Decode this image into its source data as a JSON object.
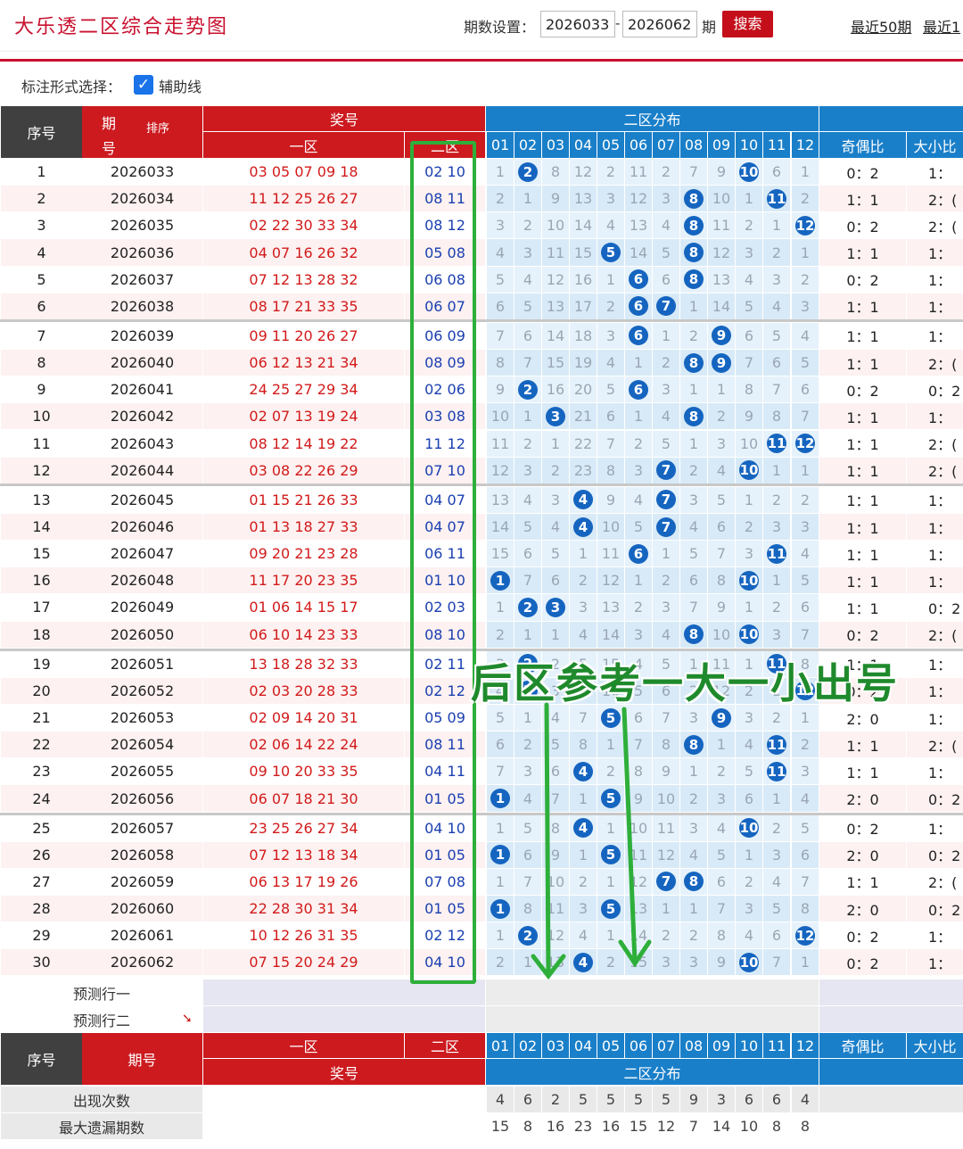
{
  "header": {
    "title": "大乐透二区综合走势图",
    "period_label": "期数设置：",
    "start_period": "2026033",
    "dash": "-",
    "end_period": "2026062",
    "period_suffix": "期",
    "search_label": "搜索",
    "links": [
      "最近50期",
      "最近1"
    ]
  },
  "options": {
    "label": "标注形式选择：",
    "checkbox_label": "辅助线",
    "checked": true
  },
  "table_header": {
    "seq": "序号",
    "period": "期",
    "period2": "号",
    "sort": "排序",
    "prize": "奖号",
    "zone1": "一区",
    "zone2": "二区",
    "dist": "二区分布",
    "columns": [
      "01",
      "02",
      "03",
      "04",
      "05",
      "06",
      "07",
      "08",
      "09",
      "10",
      "11",
      "12"
    ],
    "oe": "奇偶比",
    "bs": "大小比"
  },
  "rows": [
    {
      "n": "1",
      "p": "2026033",
      "a": "03 05 07 09 18",
      "b": "02 10",
      "m": [
        "1",
        "●2",
        "8",
        "12",
        "2",
        "11",
        "2",
        "7",
        "9",
        "●10",
        "6",
        "1"
      ],
      "oe": "0：2",
      "bs": "1："
    },
    {
      "n": "2",
      "p": "2026034",
      "a": "11 12 25 26 27",
      "b": "08 11",
      "m": [
        "2",
        "1",
        "9",
        "13",
        "3",
        "12",
        "3",
        "●8",
        "10",
        "1",
        "●11",
        "2"
      ],
      "oe": "1：1",
      "bs": "2：("
    },
    {
      "n": "3",
      "p": "2026035",
      "a": "02 22 30 33 34",
      "b": "08 12",
      "m": [
        "3",
        "2",
        "10",
        "14",
        "4",
        "13",
        "4",
        "●8",
        "11",
        "2",
        "1",
        "●12"
      ],
      "oe": "0：2",
      "bs": "2：("
    },
    {
      "n": "4",
      "p": "2026036",
      "a": "04 07 16 26 32",
      "b": "05 08",
      "m": [
        "4",
        "3",
        "11",
        "15",
        "●5",
        "14",
        "5",
        "●8",
        "12",
        "3",
        "2",
        "1"
      ],
      "oe": "1：1",
      "bs": "1："
    },
    {
      "n": "5",
      "p": "2026037",
      "a": "07 12 13 28 32",
      "b": "06 08",
      "m": [
        "5",
        "4",
        "12",
        "16",
        "1",
        "●6",
        "6",
        "●8",
        "13",
        "4",
        "3",
        "2"
      ],
      "oe": "0：2",
      "bs": "1："
    },
    {
      "n": "6",
      "p": "2026038",
      "a": "08 17 21 33 35",
      "b": "06 07",
      "m": [
        "6",
        "5",
        "13",
        "17",
        "2",
        "●6",
        "●7",
        "1",
        "14",
        "5",
        "4",
        "3"
      ],
      "oe": "1：1",
      "bs": "1："
    },
    {
      "n": "7",
      "p": "2026039",
      "a": "09 11 20 26 27",
      "b": "06 09",
      "m": [
        "7",
        "6",
        "14",
        "18",
        "3",
        "●6",
        "1",
        "2",
        "●9",
        "6",
        "5",
        "4"
      ],
      "oe": "1：1",
      "bs": "1："
    },
    {
      "n": "8",
      "p": "2026040",
      "a": "06 12 13 21 34",
      "b": "08 09",
      "m": [
        "8",
        "7",
        "15",
        "19",
        "4",
        "1",
        "2",
        "●8",
        "●9",
        "7",
        "6",
        "5"
      ],
      "oe": "1：1",
      "bs": "2：("
    },
    {
      "n": "9",
      "p": "2026041",
      "a": "24 25 27 29 34",
      "b": "02 06",
      "m": [
        "9",
        "●2",
        "16",
        "20",
        "5",
        "●6",
        "3",
        "1",
        "1",
        "8",
        "7",
        "6"
      ],
      "oe": "0：2",
      "bs": "0：2"
    },
    {
      "n": "10",
      "p": "2026042",
      "a": "02 07 13 19 24",
      "b": "03 08",
      "m": [
        "10",
        "1",
        "●3",
        "21",
        "6",
        "1",
        "4",
        "●8",
        "2",
        "9",
        "8",
        "7"
      ],
      "oe": "1：1",
      "bs": "1："
    },
    {
      "n": "11",
      "p": "2026043",
      "a": "08 12 14 19 22",
      "b": "11 12",
      "m": [
        "11",
        "2",
        "1",
        "22",
        "7",
        "2",
        "5",
        "1",
        "3",
        "10",
        "●11",
        "●12"
      ],
      "oe": "1：1",
      "bs": "2：("
    },
    {
      "n": "12",
      "p": "2026044",
      "a": "03 08 22 26 29",
      "b": "07 10",
      "m": [
        "12",
        "3",
        "2",
        "23",
        "8",
        "3",
        "●7",
        "2",
        "4",
        "●10",
        "1",
        "1"
      ],
      "oe": "1：1",
      "bs": "2：("
    },
    {
      "n": "13",
      "p": "2026045",
      "a": "01 15 21 26 33",
      "b": "04 07",
      "m": [
        "13",
        "4",
        "3",
        "●4",
        "9",
        "4",
        "●7",
        "3",
        "5",
        "1",
        "2",
        "2"
      ],
      "oe": "1：1",
      "bs": "1："
    },
    {
      "n": "14",
      "p": "2026046",
      "a": "01 13 18 27 33",
      "b": "04 07",
      "m": [
        "14",
        "5",
        "4",
        "●4",
        "10",
        "5",
        "●7",
        "4",
        "6",
        "2",
        "3",
        "3"
      ],
      "oe": "1：1",
      "bs": "1："
    },
    {
      "n": "15",
      "p": "2026047",
      "a": "09 20 21 23 28",
      "b": "06 11",
      "m": [
        "15",
        "6",
        "5",
        "1",
        "11",
        "●6",
        "1",
        "5",
        "7",
        "3",
        "●11",
        "4"
      ],
      "oe": "1：1",
      "bs": "1："
    },
    {
      "n": "16",
      "p": "2026048",
      "a": "11 17 20 23 35",
      "b": "01 10",
      "m": [
        "●1",
        "7",
        "6",
        "2",
        "12",
        "1",
        "2",
        "6",
        "8",
        "●10",
        "1",
        "5"
      ],
      "oe": "1：1",
      "bs": "1："
    },
    {
      "n": "17",
      "p": "2026049",
      "a": "01 06 14 15 17",
      "b": "02 03",
      "m": [
        "1",
        "●2",
        "●3",
        "3",
        "13",
        "2",
        "3",
        "7",
        "9",
        "1",
        "2",
        "6"
      ],
      "oe": "1：1",
      "bs": "0：2"
    },
    {
      "n": "18",
      "p": "2026050",
      "a": "06 10 14 23 33",
      "b": "08 10",
      "m": [
        "2",
        "1",
        "1",
        "4",
        "14",
        "3",
        "4",
        "●8",
        "10",
        "●10",
        "3",
        "7"
      ],
      "oe": "0：2",
      "bs": "2：("
    },
    {
      "n": "19",
      "p": "2026051",
      "a": "13 18 28 32 33",
      "b": "02 11",
      "m": [
        "3",
        "●2",
        "2",
        "5",
        "15",
        "4",
        "5",
        "1",
        "11",
        "1",
        "●11",
        "8"
      ],
      "oe": "1：1",
      "bs": "1："
    },
    {
      "n": "20",
      "p": "2026052",
      "a": "02 03 20 28 33",
      "b": "02 12",
      "m": [
        "4",
        "●2",
        "3",
        "6",
        "16",
        "5",
        "6",
        "2",
        "12",
        "2",
        "1",
        "●12"
      ],
      "oe": "0：2",
      "bs": "1："
    },
    {
      "n": "21",
      "p": "2026053",
      "a": "02 09 14 20 31",
      "b": "05 09",
      "m": [
        "5",
        "1",
        "4",
        "7",
        "●5",
        "6",
        "7",
        "3",
        "●9",
        "3",
        "2",
        "1"
      ],
      "oe": "2：0",
      "bs": "1："
    },
    {
      "n": "22",
      "p": "2026054",
      "a": "02 06 14 22 24",
      "b": "08 11",
      "m": [
        "6",
        "2",
        "5",
        "8",
        "1",
        "7",
        "8",
        "●8",
        "1",
        "4",
        "●11",
        "2"
      ],
      "oe": "1：1",
      "bs": "2：("
    },
    {
      "n": "23",
      "p": "2026055",
      "a": "09 10 20 33 35",
      "b": "04 11",
      "m": [
        "7",
        "3",
        "6",
        "●4",
        "2",
        "8",
        "9",
        "1",
        "2",
        "5",
        "●11",
        "3"
      ],
      "oe": "1：1",
      "bs": "1："
    },
    {
      "n": "24",
      "p": "2026056",
      "a": "06 07 18 21 30",
      "b": "01 05",
      "m": [
        "●1",
        "4",
        "7",
        "1",
        "●5",
        "9",
        "10",
        "2",
        "3",
        "6",
        "1",
        "4"
      ],
      "oe": "2：0",
      "bs": "0：2"
    },
    {
      "n": "25",
      "p": "2026057",
      "a": "23 25 26 27 34",
      "b": "04 10",
      "m": [
        "1",
        "5",
        "8",
        "●4",
        "1",
        "10",
        "11",
        "3",
        "4",
        "●10",
        "2",
        "5"
      ],
      "oe": "0：2",
      "bs": "1："
    },
    {
      "n": "26",
      "p": "2026058",
      "a": "07 12 13 18 34",
      "b": "01 05",
      "m": [
        "●1",
        "6",
        "9",
        "1",
        "●5",
        "11",
        "12",
        "4",
        "5",
        "1",
        "3",
        "6"
      ],
      "oe": "2：0",
      "bs": "0：2"
    },
    {
      "n": "27",
      "p": "2026059",
      "a": "06 13 17 19 26",
      "b": "07 08",
      "m": [
        "1",
        "7",
        "10",
        "2",
        "1",
        "12",
        "●7",
        "●8",
        "6",
        "2",
        "4",
        "7"
      ],
      "oe": "1：1",
      "bs": "2：("
    },
    {
      "n": "28",
      "p": "2026060",
      "a": "22 28 30 31 34",
      "b": "01 05",
      "m": [
        "●1",
        "8",
        "11",
        "3",
        "●5",
        "13",
        "1",
        "1",
        "7",
        "3",
        "5",
        "8"
      ],
      "oe": "2：0",
      "bs": "0：2"
    },
    {
      "n": "29",
      "p": "2026061",
      "a": "10 12 26 31 35",
      "b": "02 12",
      "m": [
        "1",
        "●2",
        "12",
        "4",
        "1",
        "14",
        "2",
        "2",
        "8",
        "4",
        "6",
        "●12"
      ],
      "oe": "0：2",
      "bs": "1："
    },
    {
      "n": "30",
      "p": "2026062",
      "a": "07 15 20 24 29",
      "b": "04 10",
      "m": [
        "2",
        "1",
        "13",
        "●4",
        "2",
        "15",
        "3",
        "3",
        "9",
        "●10",
        "7",
        "1"
      ],
      "oe": "0：2",
      "bs": "1："
    }
  ],
  "predict": {
    "row1": "预测行一",
    "row2": "预测行二"
  },
  "footer_header": {
    "seq": "序号",
    "period": "期号",
    "zone1": "一区",
    "zone2": "二区",
    "prize": "奖号",
    "dist": "二区分布",
    "oe": "奇偶比",
    "bs": "大小比"
  },
  "stats": [
    {
      "label": "出现次数",
      "values": [
        "4",
        "6",
        "2",
        "5",
        "5",
        "5",
        "5",
        "9",
        "3",
        "6",
        "6",
        "4"
      ]
    },
    {
      "label": "最大遗漏期数",
      "values": [
        "15",
        "8",
        "16",
        "23",
        "16",
        "15",
        "12",
        "7",
        "14",
        "10",
        "8",
        "8"
      ]
    }
  ],
  "annotation": "后区参考一大一小出号"
}
